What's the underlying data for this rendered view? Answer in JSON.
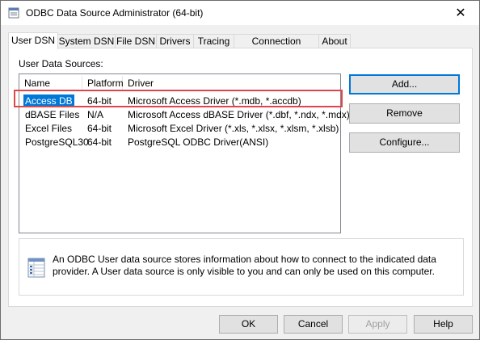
{
  "window": {
    "title": "ODBC Data Source Administrator (64-bit)",
    "close_glyph": "✕"
  },
  "tabs": [
    {
      "label": "User DSN",
      "active": true
    },
    {
      "label": "System DSN"
    },
    {
      "label": "File DSN"
    },
    {
      "label": "Drivers"
    },
    {
      "label": "Tracing"
    },
    {
      "label": "Connection Pooling"
    },
    {
      "label": "About"
    }
  ],
  "user_dsn": {
    "section_label": "User Data Sources:",
    "columns": [
      "Name",
      "Platform",
      "Driver"
    ],
    "rows": [
      {
        "name": "Access DB",
        "platform": "64-bit",
        "driver": "Microsoft Access Driver (*.mdb, *.accdb)",
        "selected": true
      },
      {
        "name": "dBASE Files",
        "platform": "N/A",
        "driver": "Microsoft Access dBASE Driver (*.dbf, *.ndx, *.mdx)"
      },
      {
        "name": "Excel Files",
        "platform": "64-bit",
        "driver": "Microsoft Excel Driver (*.xls, *.xlsx, *.xlsm, *.xlsb)"
      },
      {
        "name": "PostgreSQL30",
        "platform": "64-bit",
        "driver": "PostgreSQL ODBC Driver(ANSI)"
      }
    ],
    "buttons": {
      "add": "Add...",
      "remove": "Remove",
      "configure": "Configure..."
    },
    "info_text": "An ODBC User data source stores information about how to connect to the indicated data provider.   A User data source is only visible to you and can only be used on this computer."
  },
  "footer": {
    "ok": "OK",
    "cancel": "Cancel",
    "apply": "Apply",
    "help": "Help"
  },
  "colors": {
    "selection": "#0078d7",
    "highlight_box": "#e0454a",
    "default_button_border": "#0078d7"
  }
}
